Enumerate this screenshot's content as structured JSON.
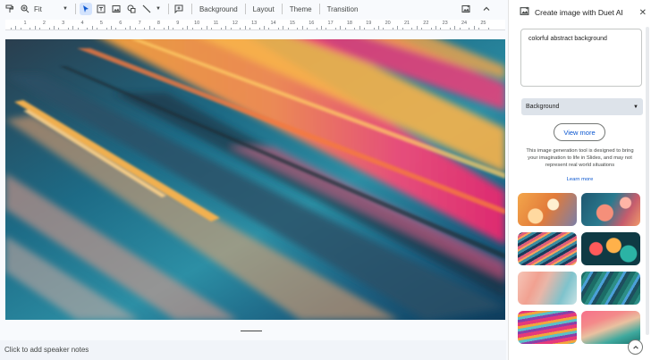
{
  "toolbar": {
    "zoom_value": "Fit",
    "background_label": "Background",
    "layout_label": "Layout",
    "theme_label": "Theme",
    "transition_label": "Transition"
  },
  "ruler": {
    "numbers": [
      "1",
      "2",
      "3",
      "4",
      "5",
      "6",
      "7",
      "8",
      "9",
      "10",
      "11",
      "12",
      "13",
      "14",
      "15",
      "16",
      "17",
      "18",
      "19",
      "20",
      "21",
      "22",
      "23",
      "24",
      "25"
    ]
  },
  "notes": {
    "placeholder": "Click to add speaker notes"
  },
  "panel": {
    "title": "Create image with Duet AI",
    "prompt_text": "colorful abstract background",
    "style_value": "Background",
    "view_more_label": "View more",
    "disclaimer": "This image generation tool is designed to bring your imagination to life in Slides, and may not represent real world situations",
    "learn_more_label": "Learn more",
    "thumbnail_count": 8
  },
  "colors": {
    "accent": "#0b57d0",
    "selected_tool_bg": "#d3e3fd",
    "select_bg": "#dde3ea"
  }
}
